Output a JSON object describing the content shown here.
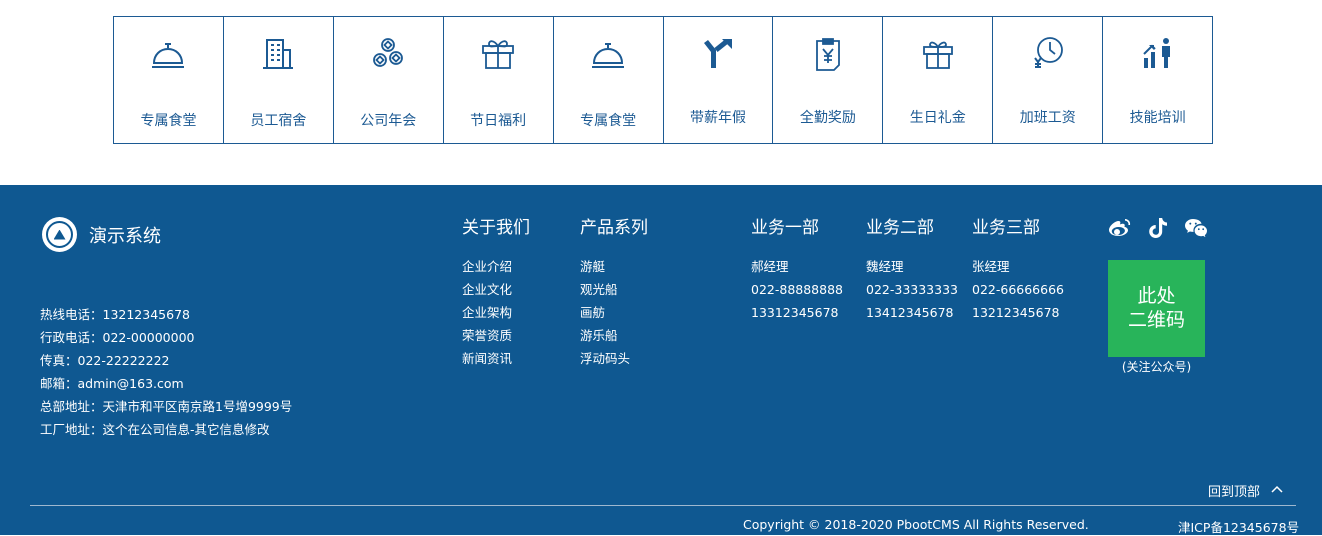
{
  "benefits": [
    {
      "label": "专属食堂",
      "icon": "cloche-icon"
    },
    {
      "label": "员工宿舍",
      "icon": "building-icon"
    },
    {
      "label": "公司年会",
      "icon": "coins-icon"
    },
    {
      "label": "节日福利",
      "icon": "gift-box-icon"
    },
    {
      "label": "专属食堂",
      "icon": "cloche-icon"
    },
    {
      "label": "带薪年假",
      "icon": "road-sign-icon"
    },
    {
      "label": "全勤奖励",
      "icon": "yen-clipboard-icon"
    },
    {
      "label": "生日礼金",
      "icon": "gift-icon"
    },
    {
      "label": "加班工资",
      "icon": "clock-yen-icon"
    },
    {
      "label": "技能培训",
      "icon": "growth-person-icon"
    }
  ],
  "footer": {
    "brand": "演示系统",
    "contact": [
      "热线电话：13212345678",
      "行政电话：022-00000000",
      "传真：022-22222222",
      "邮箱：admin@163.com",
      "总部地址：天津市和平区南京路1号增9999号",
      "工厂地址：这个在公司信息-其它信息修改"
    ],
    "about": {
      "title": "关于我们",
      "links": [
        "企业介绍",
        "企业文化",
        "企业架构",
        "荣誉资质",
        "新闻资讯"
      ]
    },
    "products": {
      "title": "产品系列",
      "links": [
        "游艇",
        "观光船",
        "画舫",
        "游乐船",
        "浮动码头"
      ]
    },
    "departments": [
      {
        "title": "业务一部",
        "lines": [
          "郝经理",
          "022-88888888",
          "13312345678"
        ]
      },
      {
        "title": "业务二部",
        "lines": [
          "魏经理",
          "022-33333333",
          "13412345678"
        ]
      },
      {
        "title": "业务三部",
        "lines": [
          "张经理",
          "022-66666666",
          "13212345678"
        ]
      }
    ],
    "social_icons": [
      "weibo-icon",
      "tiktok-icon",
      "wechat-icon"
    ],
    "qr_text": [
      "此处",
      "二维码"
    ],
    "qr_caption": "(关注公众号)",
    "back_to_top": "回到顶部",
    "copyright": "Copyright © 2018-2020 PbootCMS All Rights Reserved.",
    "icp": "津ICP备12345678号"
  },
  "colors": {
    "benefit_blue": "#1c5a93",
    "footer_bg": "#0f5891",
    "qr_green": "#28b45a"
  }
}
